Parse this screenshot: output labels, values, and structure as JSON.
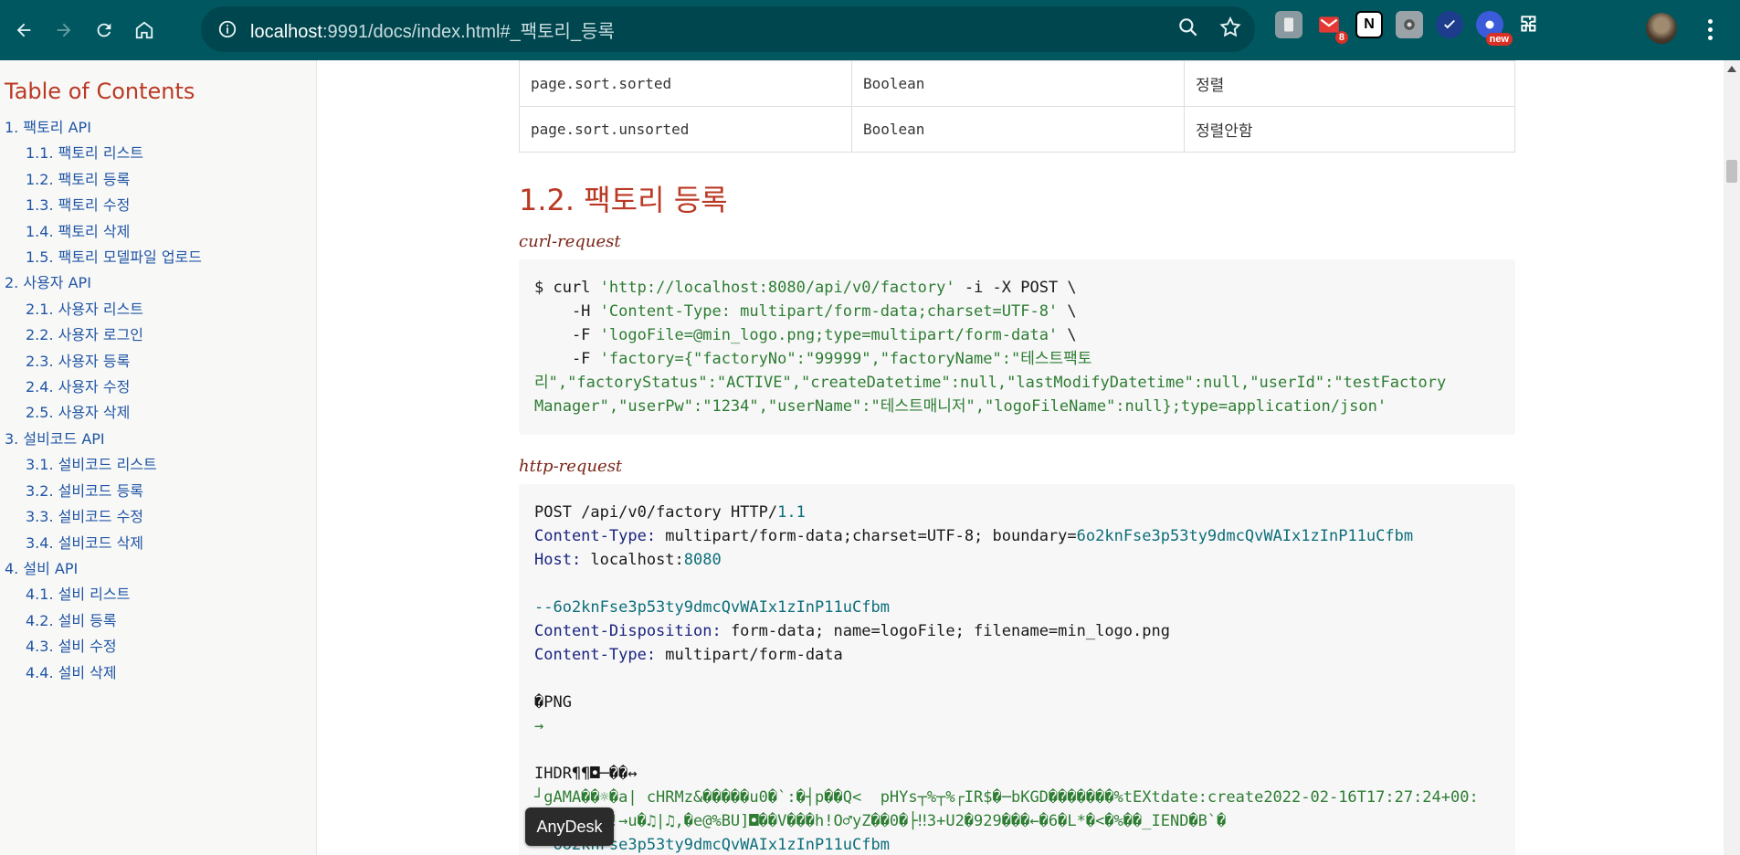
{
  "browser": {
    "url_host": "localhost",
    "url_rest": ":9991/docs/index.html#_팩토리_등록",
    "ext_badge_count": "8",
    "ext_badge_new": "new",
    "ext_notion": "N"
  },
  "toc": {
    "title": "Table of Contents",
    "items": [
      {
        "label": "1. 팩토리 API",
        "level": 1
      },
      {
        "label": "1.1. 팩토리 리스트",
        "level": 2
      },
      {
        "label": "1.2. 팩토리 등록",
        "level": 2
      },
      {
        "label": "1.3. 팩토리 수정",
        "level": 2
      },
      {
        "label": "1.4. 팩토리 삭제",
        "level": 2
      },
      {
        "label": "1.5. 팩토리 모델파일 업로드",
        "level": 2
      },
      {
        "label": "2. 사용자 API",
        "level": 1
      },
      {
        "label": "2.1. 사용자 리스트",
        "level": 2
      },
      {
        "label": "2.2. 사용자 로그인",
        "level": 2
      },
      {
        "label": "2.3. 사용자 등록",
        "level": 2
      },
      {
        "label": "2.4. 사용자 수정",
        "level": 2
      },
      {
        "label": "2.5. 사용자 삭제",
        "level": 2
      },
      {
        "label": "3. 설비코드 API",
        "level": 1
      },
      {
        "label": "3.1. 설비코드 리스트",
        "level": 2
      },
      {
        "label": "3.2. 설비코드 등록",
        "level": 2
      },
      {
        "label": "3.3. 설비코드 수정",
        "level": 2
      },
      {
        "label": "3.4. 설비코드 삭제",
        "level": 2
      },
      {
        "label": "4. 설비 API",
        "level": 1
      },
      {
        "label": "4.1. 설비 리스트",
        "level": 2
      },
      {
        "label": "4.2. 설비 등록",
        "level": 2
      },
      {
        "label": "4.3. 설비 수정",
        "level": 2
      },
      {
        "label": "4.4. 설비 삭제",
        "level": 2
      }
    ]
  },
  "table": {
    "rows": [
      [
        "page.sort.sorted",
        "Boolean",
        "정렬"
      ],
      [
        "page.sort.unsorted",
        "Boolean",
        "정렬안함"
      ]
    ]
  },
  "section": {
    "heading": "1.2. 팩토리 등록",
    "curl_label": "curl-request",
    "http_label": "http-request"
  },
  "curl": {
    "l1a": "$ curl ",
    "l1b": "'http://localhost:8080/api/v0/factory'",
    "l1c": " -i -X POST \\",
    "l2a": "    -H ",
    "l2b": "'Content-Type: multipart/form-data;charset=UTF-8'",
    "l2c": " \\",
    "l3a": "    -F ",
    "l3b": "'logoFile=@min_logo.png;type=multipart/form-data'",
    "l3c": " \\",
    "l4a": "    -F ",
    "l4b": "'factory={\"factoryNo\":\"99999\",\"factoryName\":\"테스트팩토",
    "l5": "리\",\"factoryStatus\":\"ACTIVE\",\"createDatetime\":null,\"lastModifyDatetime\":null,\"userId\":\"testFactory",
    "l6": "Manager\",\"userPw\":\"1234\",\"userName\":\"테스트매니저\",\"logoFileName\":null};type=application/json'"
  },
  "http": {
    "l1a": "POST ",
    "l1b": "/api/v0/factory HTTP/",
    "l1c": "1.1",
    "l2a": "Content-Type: ",
    "l2b": "multipart/form-data;charset=UTF-8; boundary=",
    "l2c": "6o2knFse3p53ty9dmcQvWAIx1zInP11uCfbm",
    "l3a": "Host: ",
    "l3b": "localhost:",
    "l3c": "8080",
    "l5": "--6o2knFse3p53ty9dmcQvWAIx1zInP11uCfbm",
    "l6a": "Content-Disposition: ",
    "l6b": "form-data; name=logoFile; filename=min_logo.png",
    "l7a": "Content-Type: ",
    "l7b": "multipart/form-data",
    "l9": "�PNG",
    "l10": "→",
    "l12": "IHDR¶¶◘─��↔",
    "l13": "┘gAMA��☼�a| cHRMz&�����u0�`:�┤p��Q<  pHYs┬%┬%┌IR$�─bKGD�������%tEXtdate:create2022-02-16T17:27:24+00:",
    "l14": "      ↔?!→u�♫|♫,�e@%BU]◘��V���h!O♂yZ��0�├‼3+U2�929���←�6�L*�<�%��_IEND�B`�",
    "l15": "--6o2knFse3p53ty9dmcQvWAIx1zInP11uCfbm"
  },
  "tooltip": "AnyDesk"
}
